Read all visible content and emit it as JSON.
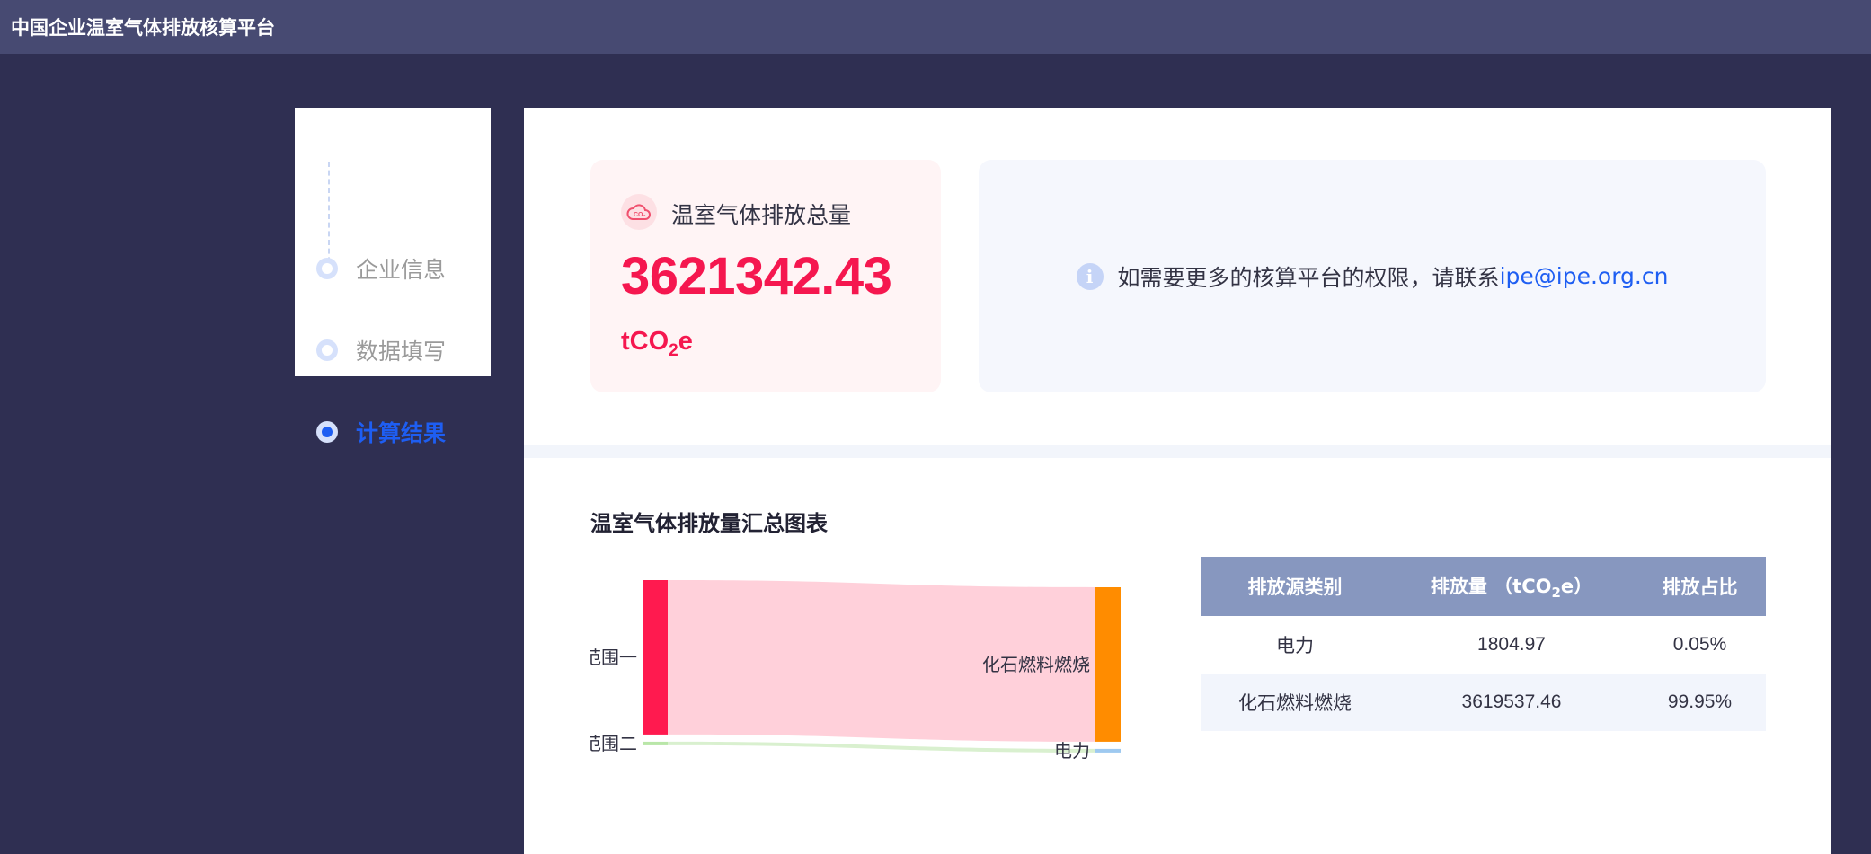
{
  "app": {
    "title": "中国企业温室气体排放核算平台"
  },
  "steps": [
    {
      "label": "企业信息",
      "active": false
    },
    {
      "label": "数据填写",
      "active": false
    },
    {
      "label": "计算结果",
      "active": true
    }
  ],
  "summary": {
    "label": "温室气体排放总量",
    "value": "3621342.43",
    "unit_prefix": "tCO",
    "unit_sub": "2",
    "unit_suffix": "e",
    "icon": "co2-cloud-icon"
  },
  "notice": {
    "text": "如需要更多的核算平台的权限，请联系",
    "email": "ipe@ipe.org.cn",
    "icon": "info-icon"
  },
  "section_title": "温室气体排放量汇总图表",
  "chart_data": {
    "type": "sankey",
    "nodes": [
      {
        "name": "范围一",
        "side": "left",
        "color": "#ff1a4f"
      },
      {
        "name": "范围二",
        "side": "left",
        "color": "#b9e6a8"
      },
      {
        "name": "化石燃料燃烧",
        "side": "right",
        "color": "#ff8c00"
      },
      {
        "name": "电力",
        "side": "right",
        "color": "#9ec9f0"
      }
    ],
    "links": [
      {
        "source": "范围一",
        "target": "化石燃料燃烧",
        "value": 3619537.46
      },
      {
        "source": "范围二",
        "target": "电力",
        "value": 1804.97
      }
    ]
  },
  "table": {
    "headers": {
      "category": "排放源类别",
      "amount_prefix": "排放量 （tCO",
      "amount_sub": "2",
      "amount_suffix": "e）",
      "share": "排放占比"
    },
    "rows": [
      {
        "category": "电力",
        "amount": "1804.97",
        "share": "0.05%"
      },
      {
        "category": "化石燃料燃烧",
        "amount": "3619537.46",
        "share": "99.95%"
      }
    ]
  },
  "colors": {
    "accent": "#1e5ef2",
    "total": "#f5174f",
    "table_header": "#8797bf"
  }
}
